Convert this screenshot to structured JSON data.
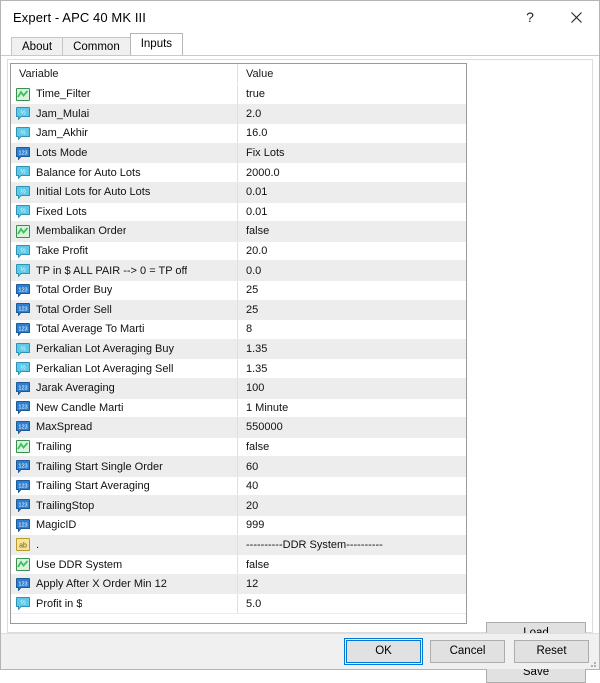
{
  "window": {
    "title": "Expert - APC 40 MK III",
    "help_label": "?",
    "close_label": "×"
  },
  "tabs": [
    {
      "label": "About",
      "active": false
    },
    {
      "label": "Common",
      "active": false
    },
    {
      "label": "Inputs",
      "active": true
    }
  ],
  "grid": {
    "headers": {
      "variable": "Variable",
      "value": "Value"
    },
    "rows": [
      {
        "icon": "bool-icon",
        "type": "bool",
        "variable": "Time_Filter",
        "value": "true"
      },
      {
        "icon": "double-icon",
        "type": "double",
        "variable": "Jam_Mulai",
        "value": "2.0"
      },
      {
        "icon": "double-icon",
        "type": "double",
        "variable": "Jam_Akhir",
        "value": "16.0"
      },
      {
        "icon": "int-icon",
        "type": "int",
        "variable": "Lots Mode",
        "value": "Fix Lots"
      },
      {
        "icon": "double-icon",
        "type": "double",
        "variable": "Balance for Auto Lots",
        "value": "2000.0"
      },
      {
        "icon": "double-icon",
        "type": "double",
        "variable": "Initial Lots for Auto Lots",
        "value": "0.01"
      },
      {
        "icon": "double-icon",
        "type": "double",
        "variable": "Fixed Lots",
        "value": "0.01"
      },
      {
        "icon": "bool-icon",
        "type": "bool",
        "variable": "Membalikan Order",
        "value": "false"
      },
      {
        "icon": "double-icon",
        "type": "double",
        "variable": "Take Profit",
        "value": "20.0"
      },
      {
        "icon": "double-icon",
        "type": "double",
        "variable": "TP in $ ALL PAIR --> 0 = TP off",
        "value": "0.0"
      },
      {
        "icon": "int-icon",
        "type": "int",
        "variable": "Total Order Buy",
        "value": "25"
      },
      {
        "icon": "int-icon",
        "type": "int",
        "variable": "Total Order Sell",
        "value": "25"
      },
      {
        "icon": "int-icon",
        "type": "int",
        "variable": "Total Average To Marti",
        "value": "8"
      },
      {
        "icon": "double-icon",
        "type": "double",
        "variable": "Perkalian Lot Averaging Buy",
        "value": "1.35"
      },
      {
        "icon": "double-icon",
        "type": "double",
        "variable": "Perkalian Lot Averaging Sell",
        "value": "1.35"
      },
      {
        "icon": "int-icon",
        "type": "int",
        "variable": "Jarak Averaging",
        "value": "100"
      },
      {
        "icon": "int-icon",
        "type": "int",
        "variable": "New Candle Marti",
        "value": "1 Minute"
      },
      {
        "icon": "int-icon",
        "type": "int",
        "variable": "MaxSpread",
        "value": "550000"
      },
      {
        "icon": "bool-icon",
        "type": "bool",
        "variable": "Trailing",
        "value": "false"
      },
      {
        "icon": "int-icon",
        "type": "int",
        "variable": "Trailing Start Single Order",
        "value": "60"
      },
      {
        "icon": "int-icon",
        "type": "int",
        "variable": "Trailing Start Averaging",
        "value": "40"
      },
      {
        "icon": "int-icon",
        "type": "int",
        "variable": "TrailingStop",
        "value": "20"
      },
      {
        "icon": "int-icon",
        "type": "int",
        "variable": "MagicID",
        "value": "999"
      },
      {
        "icon": "string-icon",
        "type": "string",
        "variable": ".",
        "value": "----------DDR System----------"
      },
      {
        "icon": "bool-icon",
        "type": "bool",
        "variable": "Use DDR System",
        "value": "false"
      },
      {
        "icon": "int-icon",
        "type": "int",
        "variable": "Apply After X Order Min 12",
        "value": "12"
      },
      {
        "icon": "double-icon",
        "type": "double",
        "variable": "Profit in $",
        "value": "5.0"
      }
    ]
  },
  "side_buttons": [
    {
      "label": "Load"
    },
    {
      "label": "Save"
    }
  ],
  "footer_buttons": [
    {
      "label": "OK",
      "default": true
    },
    {
      "label": "Cancel",
      "default": false
    },
    {
      "label": "Reset",
      "default": false
    }
  ],
  "colors": {
    "bool_icon": "#3fbf5f",
    "double_icon": "#5ec8e8",
    "int_icon": "#2f7fd0",
    "string_icon": "#e8c33a",
    "focus_blue": "#0078d7",
    "row_alt": "#ededed"
  }
}
